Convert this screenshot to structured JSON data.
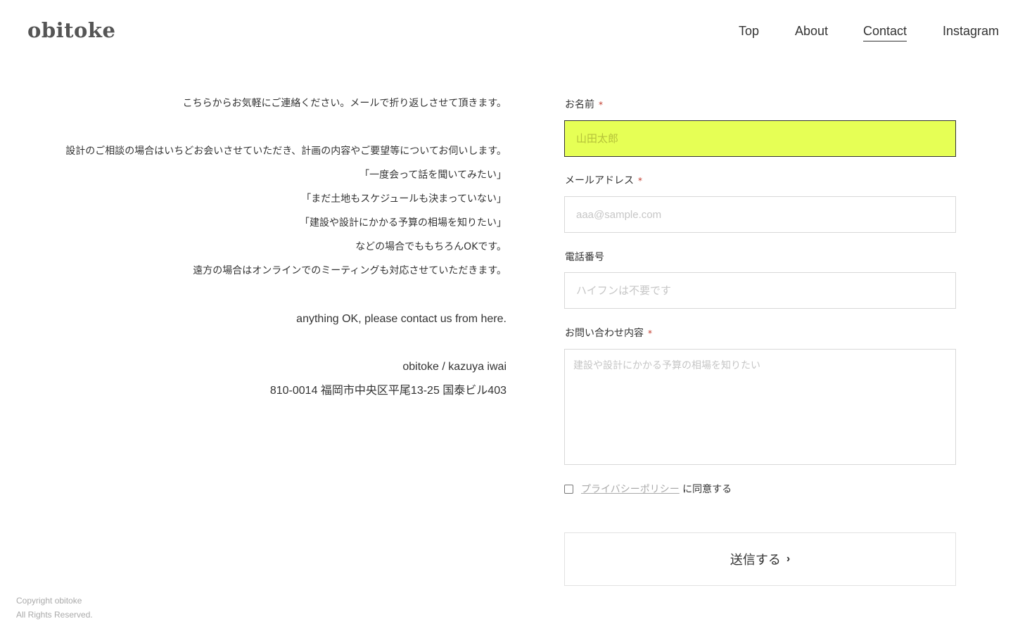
{
  "site": {
    "logo": "obitoke"
  },
  "nav": [
    {
      "label": "Top"
    },
    {
      "label": "About"
    },
    {
      "label": "Contact",
      "active": true
    },
    {
      "label": "Instagram"
    }
  ],
  "intro": {
    "lines": [
      "こちらからお気軽にご連絡ください。メールで折り返しさせて頂きます。",
      "設計のご相談の場合はいちどお会いさせていただき、計画の内容やご要望等についてお伺いします。",
      "「一度会って話を聞いてみたい」",
      "「まだ土地もスケジュールも決まっていない」",
      "「建設や設計にかかる予算の相場を知りたい」",
      "などの場合でももちろんOKです。",
      "遠方の場合はオンラインでのミーティングも対応させていただきます。"
    ],
    "english": "anything OK, please contact us from here.",
    "signature": "obitoke / kazuya iwai",
    "address": "810-0014 福岡市中央区平尾13-25 国泰ビル403"
  },
  "form": {
    "name": {
      "label": "お名前",
      "required_mark": "*",
      "placeholder": "山田太郎",
      "value": ""
    },
    "email": {
      "label": "メールアドレス",
      "required_mark": "*",
      "placeholder": "aaa@sample.com",
      "value": ""
    },
    "phone": {
      "label": "電話番号",
      "placeholder": "ハイフンは不要です",
      "value": ""
    },
    "message": {
      "label": "お問い合わせ内容",
      "required_mark": "*",
      "placeholder": "建設や設計にかかる予算の相場を知りたい",
      "value": ""
    },
    "consent": {
      "link_text": "プライバシーポリシー",
      "suffix": " に同意する",
      "checked": false
    },
    "submit_label": "送信する",
    "submit_icon": "chevron-right-icon"
  },
  "footer": {
    "copyright_line1": "Copyright obitoke",
    "copyright_line2": "All Rights Reserved."
  },
  "colors": {
    "focused_field": "#e6ff55",
    "required": "#c0392b",
    "text": "#333333",
    "muted": "#aaaaaa"
  }
}
